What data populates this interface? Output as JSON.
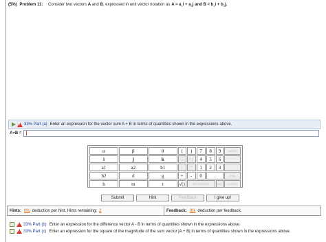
{
  "problem": {
    "percent": "(5%)",
    "number": "Problem 11:",
    "text_pre": "Consider two vectors",
    "vec_a": "A",
    "and": "and",
    "vec_b": "B",
    "text_mid": ", expressed in unit vector notation as",
    "eq_a": "A = a",
    "eq_a_sub1": "1",
    "eq_a_mid": "i + a",
    "eq_a_sub2": "2",
    "eq_a_end": "j and",
    "eq_b": "B = b",
    "eq_b_sub1": "1",
    "eq_b_mid": "i + b",
    "eq_b_sub2": "2",
    "eq_b_end": "j."
  },
  "part_a": {
    "label": "33% Part (a)",
    "text": "Enter an expression for the vector sum A + B in terms of quantities shown in the expressions above.",
    "answer_label": "A+B =",
    "answer_value": ""
  },
  "keypad": {
    "symbols": [
      [
        "α",
        "β",
        "θ"
      ],
      [
        "i",
        "j",
        "k"
      ],
      [
        "a1",
        "a2",
        "b1"
      ],
      [
        "b2",
        "d",
        "g"
      ],
      [
        "h",
        "m",
        "t"
      ]
    ],
    "row1_right": [
      "(",
      ")",
      "7",
      "8",
      "9",
      "HOME"
    ],
    "row2_right": [
      "↑^",
      "^↓",
      "4",
      "5",
      "6",
      "←"
    ],
    "row3_right": [
      "/",
      "*",
      "1",
      "2",
      "3",
      "→"
    ],
    "row4_right": [
      "+",
      "-",
      "0",
      ".",
      "END"
    ],
    "row5_right": [
      "√()",
      "BACKSPACE",
      "DEL",
      "CLEAR"
    ]
  },
  "actions": {
    "submit": "Submit",
    "hint": "Hint",
    "feedback": "Feedback",
    "give_up": "I give up!"
  },
  "hints": {
    "title": "Hints:",
    "percent": "0%",
    "text": "deduction per hint. Hints remaining:",
    "remaining": "2"
  },
  "feedback": {
    "title": "Feedback:",
    "percent": "0%",
    "text": "deduction per feedback."
  },
  "part_b": {
    "label": "33% Part (b)",
    "text": "Enter an expression for the difference vector A - B in terms of quantities shown in the expressions above."
  },
  "part_c": {
    "label": "33% Part (c)",
    "text": "Enter an expression for the square of the magnitude of the sum vector |A + B| in terms of quantities shown in the expressions above."
  }
}
